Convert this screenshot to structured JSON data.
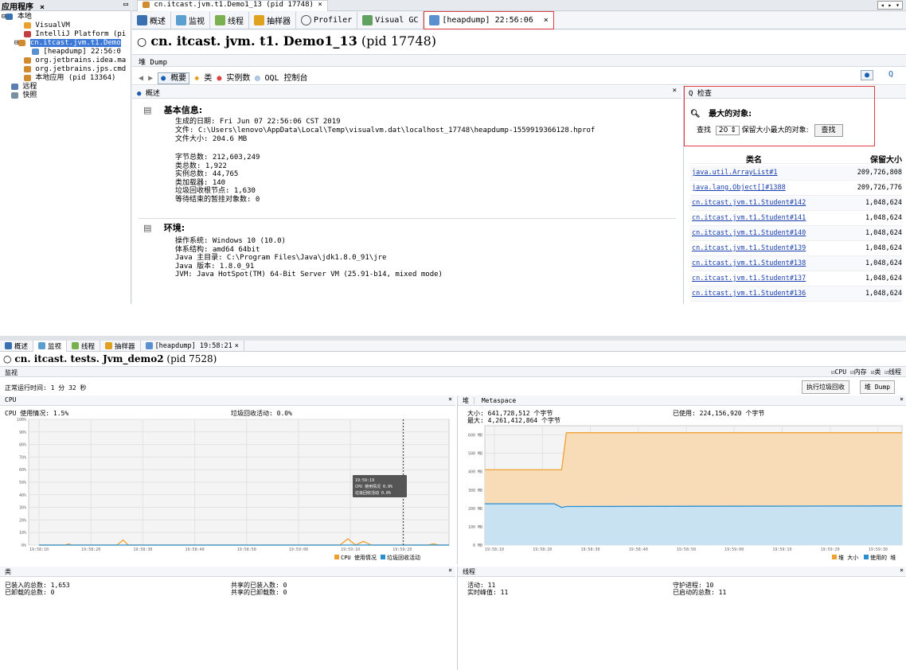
{
  "top": {
    "sidebar": {
      "title": "应用程序",
      "tree": [
        "本地",
        "VisualVM",
        "IntelliJ Platform (pi",
        "cn.itcast.jvm.t1.Demo",
        "[heapdump] 22:56:0",
        "org.jetbrains.idea.ma",
        "org.jetbrains.jps.cmd",
        "本地应用 (pid 13364)",
        "远程",
        "快照"
      ]
    },
    "doc_tab": "cn.itcast.jvm.t1.Demo1_13 (pid 17748)",
    "subtabs": [
      "概述",
      "监视",
      "线程",
      "抽样器",
      "Profiler",
      "Visual GC",
      "[heapdump] 22:56:06"
    ],
    "title_name": "cn. itcast. jvm. t1. Demo1_13",
    "title_pid": "(pid 17748)",
    "heap_dump_label": "堆 Dump",
    "toolbar": {
      "summary": "概要",
      "classes": "类",
      "instances": "实例数",
      "oql": "OQL 控制台"
    },
    "overview_title": "概述",
    "basic_info_title": "基本信息:",
    "basic_info": [
      "生成的日期: Fri Jun 07 22:56:06 CST 2019",
      "文件: C:\\Users\\lenovo\\AppData\\Local\\Temp\\visualvm.dat\\localhost_17748\\heapdump-1559919366128.hprof",
      "文件大小: 204.6 MB"
    ],
    "stats": [
      "字节总数: 212,603,249",
      "类总数: 1,922",
      "实例总数: 44,765",
      "类加载器: 140",
      "垃圾回收根节点: 1,630",
      "等待结束的暂挂对象数: 0"
    ],
    "env_title": "环境:",
    "env": [
      "操作系统: Windows 10 (10.0)",
      "体系结构: amd64 64bit",
      "Java 主目录: C:\\Program Files\\Java\\jdk1.8.0_91\\jre",
      "Java 版本: 1.8.0_91",
      "JVM: Java HotSpot(TM) 64-Bit Server VM (25.91-b14, mixed mode)"
    ],
    "inspect": {
      "title": "检查",
      "largest": "最大的对象:",
      "find_prefix": "查找",
      "count": "20",
      "find_suffix": "保留大小最大的对象:",
      "find_button": "查找",
      "col_class": "类名",
      "col_size": "保留大小",
      "rows": [
        [
          "java.util.ArrayList#1",
          "209,726,808"
        ],
        [
          "java.lang.Object[]#1388",
          "209,726,776"
        ],
        [
          "cn.itcast.jvm.t1.Student#142",
          "1,048,624"
        ],
        [
          "cn.itcast.jvm.t1.Student#141",
          "1,048,624"
        ],
        [
          "cn.itcast.jvm.t1.Student#140",
          "1,048,624"
        ],
        [
          "cn.itcast.jvm.t1.Student#139",
          "1,048,624"
        ],
        [
          "cn.itcast.jvm.t1.Student#138",
          "1,048,624"
        ],
        [
          "cn.itcast.jvm.t1.Student#137",
          "1,048,624"
        ],
        [
          "cn.itcast.jvm.t1.Student#136",
          "1,048,624"
        ]
      ]
    }
  },
  "bottom": {
    "subtabs": [
      "概述",
      "监视",
      "线程",
      "抽样器",
      "[heapdump] 19:58:21"
    ],
    "title_name": "cn. itcast. tests. Jvm_demo2",
    "title_pid": "(pid 7528)",
    "monitor_label": "监视",
    "checks": [
      "CPU",
      "内存",
      "类",
      "线程"
    ],
    "uptime": "正常运行时间: 1 分 32 秒",
    "gc_button": "执行垃圾回收",
    "heap_dump_button": "堆 Dump",
    "cpu_panel": {
      "title": "CPU",
      "usage": "CPU 使用情况: 1.5%",
      "gc_activity": "垃圾回收活动: 0.0%",
      "tooltip": [
        "19:59:19",
        "CPU 使用情况  0.0%",
        "垃圾回收活动  0.0%"
      ],
      "legend": [
        "CPU 使用情况",
        "垃圾回收活动"
      ]
    },
    "heap_panel": {
      "tab1": "堆",
      "tab2": "Metaspace",
      "size": "大小: 641,728,512 个字节",
      "max": "最大: 4,261,412,864 个字节",
      "used": "已使用: 224,156,920 个字节",
      "legend": [
        "堆 大小",
        "使用的 堆"
      ]
    },
    "classes_panel": {
      "title": "类",
      "loaded": "已装入的总数: 1,653",
      "unloaded": "已卸载的总数: 0",
      "shared_loaded": "共享的已装入数: 0",
      "shared_unloaded": "共享的已卸载数: 0"
    },
    "threads_panel": {
      "title": "线程",
      "live": "活动: 11",
      "peak": "实时峰值: 11",
      "daemon": "守护进程: 10",
      "started": "已启动的总数: 11"
    }
  },
  "chart_data": [
    {
      "type": "line",
      "title": "CPU",
      "x": [
        "19:58:10",
        "19:58:20",
        "19:58:30",
        "19:58:40",
        "19:58:50",
        "19:59:00",
        "19:59:10",
        "19:59:20"
      ],
      "ylim": [
        0,
        100
      ],
      "yticks": [
        "0%",
        "10%",
        "20%",
        "30%",
        "40%",
        "50%",
        "60%",
        "70%",
        "80%",
        "90%",
        "100%"
      ],
      "series": [
        {
          "name": "CPU 使用情况",
          "color": "#f0a030",
          "points": [
            [
              0,
              0
            ],
            [
              0.5,
              0
            ],
            [
              0.58,
              1
            ],
            [
              0.62,
              0
            ],
            [
              1.5,
              0
            ],
            [
              1.62,
              4
            ],
            [
              1.72,
              0
            ],
            [
              3,
              0
            ],
            [
              5.8,
              0
            ],
            [
              5.95,
              5
            ],
            [
              6.1,
              0
            ],
            [
              6.25,
              3
            ],
            [
              6.4,
              0
            ],
            [
              7,
              0
            ],
            [
              7.5,
              0
            ],
            [
              7.6,
              1
            ],
            [
              7.7,
              0
            ],
            [
              8,
              0
            ]
          ]
        },
        {
          "name": "垃圾回收活动",
          "color": "#2a8fd0",
          "points": [
            [
              0,
              0
            ],
            [
              8,
              0
            ]
          ]
        }
      ]
    },
    {
      "type": "area",
      "title": "堆",
      "x": [
        "19:58:10",
        "19:58:20",
        "19:58:30",
        "19:58:40",
        "19:58:50",
        "19:59:00",
        "19:59:10",
        "19:59:20",
        "19:59:30"
      ],
      "ylim": [
        0,
        650
      ],
      "yticks": [
        "0 MB",
        "100 MB",
        "200 MB",
        "300 MB",
        "400 MB",
        "500 MB",
        "600 MB"
      ],
      "series": [
        {
          "name": "堆 大小",
          "color": "#f0a030",
          "points": [
            [
              -0.2,
              410
            ],
            [
              1.4,
              410
            ],
            [
              1.5,
              612
            ],
            [
              8.5,
              612
            ]
          ]
        },
        {
          "name": "使用的 堆",
          "color": "#2a8fd0",
          "points": [
            [
              -0.2,
              225
            ],
            [
              1.25,
              225
            ],
            [
              1.4,
              205
            ],
            [
              1.5,
              210
            ],
            [
              8.5,
              213
            ]
          ]
        }
      ]
    }
  ]
}
